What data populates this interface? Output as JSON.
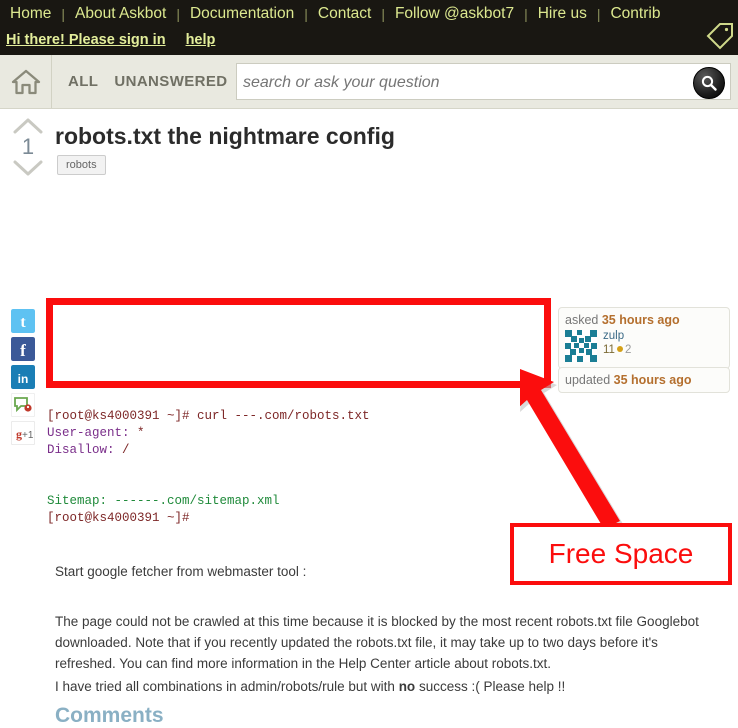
{
  "header": {
    "nav_items": [
      {
        "label": "Home"
      },
      {
        "label": "About Askbot"
      },
      {
        "label": "Documentation"
      },
      {
        "label": "Contact"
      },
      {
        "label": "Follow @askbot7"
      },
      {
        "label": "Hire us"
      },
      {
        "label": "Contrib"
      }
    ],
    "separator": "|",
    "signin_label": "Hi there! Please sign in",
    "help_label": "help",
    "tag_icon": "tag-icon",
    "link_color": "#dce88f",
    "background": "#191712"
  },
  "secondary_bar": {
    "home_icon": "home-icon",
    "scopes": [
      {
        "label": "ALL"
      },
      {
        "label": "UNANSWERED"
      }
    ],
    "search": {
      "value": "",
      "placeholder": "search or ask your question",
      "button_icon": "search-icon"
    }
  },
  "question": {
    "title": "robots.txt the nightmare config",
    "vote_count": "1",
    "upvote_icon": "chevron-up-icon",
    "downvote_icon": "chevron-down-icon",
    "tags": [
      {
        "label": "robots"
      }
    ],
    "asked": {
      "prefix": "asked ",
      "time": "35 hours ago",
      "username": "zulp",
      "avatar_icon": "identicon-avatar",
      "karma": "11",
      "badge_count": "2"
    },
    "updated": {
      "prefix": "updated ",
      "time": "35 hours ago"
    },
    "code_lines": [
      {
        "segments": [
          {
            "text": "[root@ks4000391 ~]# ",
            "cls": "c-prompt"
          },
          {
            "text": "curl ---.com/robots.txt",
            "cls": "c-prompt"
          }
        ]
      },
      {
        "segments": [
          {
            "text": "User-agent: ",
            "cls": "c-purple"
          },
          {
            "text": "*",
            "cls": "c-prompt"
          }
        ]
      },
      {
        "segments": [
          {
            "text": "Disallow: ",
            "cls": "c-purple"
          },
          {
            "text": "/",
            "cls": "c-prompt"
          }
        ]
      },
      {
        "segments": []
      },
      {
        "segments": []
      },
      {
        "segments": [
          {
            "text": "Sitemap: ------.com/sitemap.xml",
            "cls": "c-green"
          }
        ]
      },
      {
        "segments": [
          {
            "text": "[root@ks4000391 ~]#",
            "cls": "c-prompt"
          }
        ]
      }
    ],
    "paragraph_1": "Start google fetcher from webmaster tool :",
    "paragraph_2": "The page could not be crawled at this time because it is blocked by the most recent robots.txt file Googlebot downloaded. Note that if you recently updated the robots.txt file, it may take up to two days before it's refreshed. You can find more information in the Help Center article about robots.txt.",
    "paragraph_3_a": "I have tried all combinations in admin/robots/rule but with ",
    "paragraph_3_bold": "no",
    "paragraph_3_b": " success :( Please help !!",
    "comments_heading": "Comments"
  },
  "social": [
    {
      "name": "twitter-icon",
      "label": "t",
      "color": "#4ab3f4"
    },
    {
      "name": "facebook-icon",
      "label": "f",
      "color": "#3b5998"
    },
    {
      "name": "linkedin-icon",
      "label": "in",
      "color": "#0e76a8"
    },
    {
      "name": "identica-icon",
      "label": "",
      "color": "#ffffff"
    },
    {
      "name": "google-plus-one-icon",
      "label": "g +1",
      "color": "#ffffff"
    }
  ],
  "annotations": {
    "highlight_rect": {
      "name": "empty-area-highlight",
      "color": "#fb0d0d"
    },
    "arrow": {
      "name": "red-arrow",
      "color": "#fb0d0d"
    },
    "callout_label": "Free Space",
    "callout_color": "#fb0d0d"
  }
}
